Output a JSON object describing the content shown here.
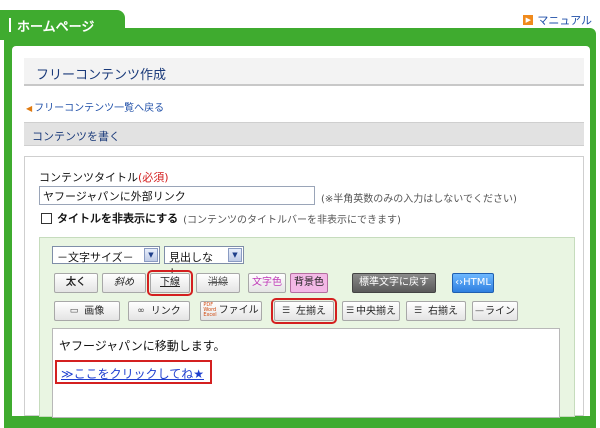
{
  "header": {
    "title": "ホームページ",
    "manual_label": "マニュアル"
  },
  "page": {
    "title": "フリーコンテンツ作成",
    "back_link": "フリーコンテンツ一覧へ戻る",
    "section_title": "コンテンツを書く"
  },
  "form": {
    "title_label": "コンテンツタイトル",
    "required": "(必須)",
    "title_value": "ヤフージャパンに外部リンク",
    "title_hint": "(※半角英数のみの入力はしないでください)",
    "hide_title_label": "タイトルを非表示にする",
    "hide_title_note": "(コンテンツのタイトルバーを非表示にできます)",
    "hide_title_checked": false
  },
  "toolbar": {
    "font_size_select": "－文字サイズ－",
    "heading_select": "見出しなし",
    "bold": "太く",
    "italic": "斜め",
    "underline": "下線",
    "strike": "消線",
    "text_color": "文字色",
    "bg_color": "背景色",
    "reset_text": "標準文字に戻す",
    "html": "HTML",
    "image": "画像",
    "link": "リンク",
    "file": "ファイル",
    "align_left": "左揃え",
    "align_center": "中央揃え",
    "align_right": "右揃え",
    "rule": "ライン"
  },
  "editor": {
    "line1": "ヤフージャパンに移動します。",
    "link_text": "≫ここをクリックしてね★"
  },
  "colors": {
    "brand_green": "#3fab2f",
    "highlight_red": "#d42020",
    "link_blue": "#1f3fd0"
  }
}
